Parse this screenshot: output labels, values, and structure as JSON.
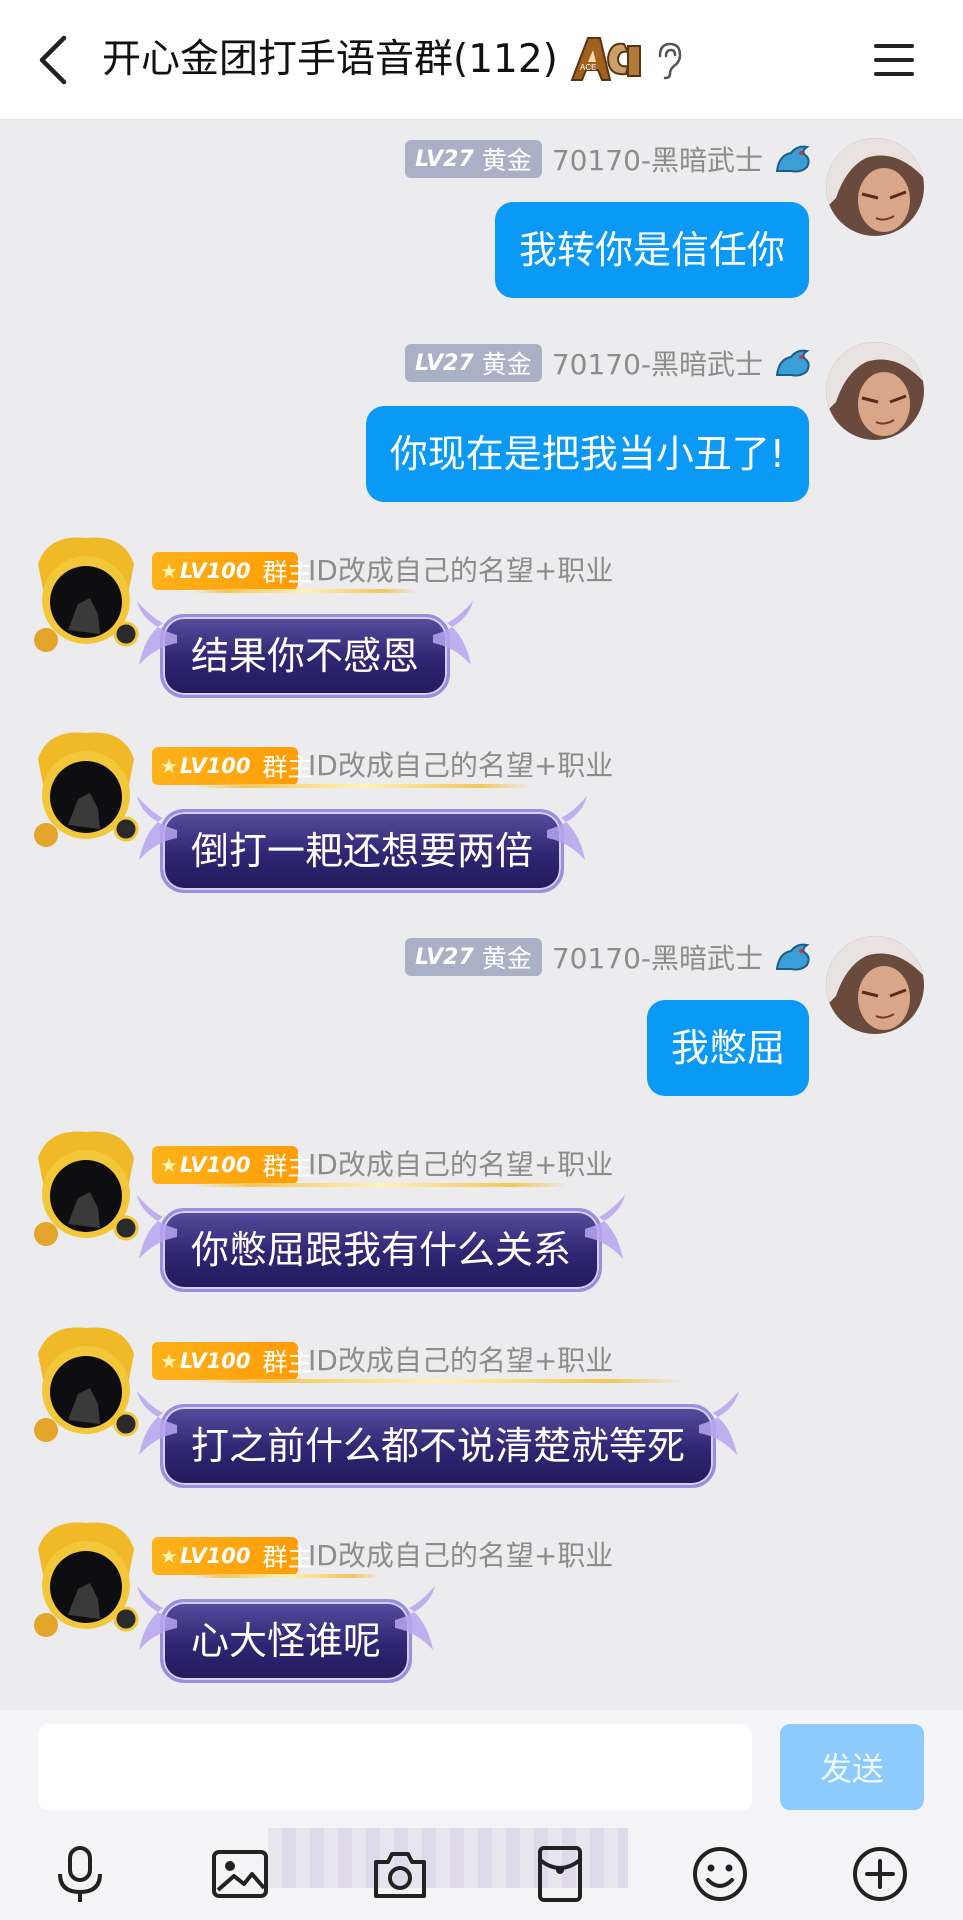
{
  "header": {
    "title": "开心金团打手语音群(112)",
    "ace_badge": "ACE",
    "icons": [
      "back-icon",
      "ear-icon",
      "menu-icon"
    ]
  },
  "self_user": {
    "level": "LV27",
    "rank": "黄金",
    "name": "70170-黑暗武士"
  },
  "owner_user": {
    "level": "LV100",
    "role": "群主",
    "name": "ID改成自己的名望+职业"
  },
  "messages": [
    {
      "side": "self",
      "text": "我转你是信任你"
    },
    {
      "side": "self",
      "text": "你现在是把我当小丑了!"
    },
    {
      "side": "owner",
      "text": "结果你不感恩"
    },
    {
      "side": "owner",
      "text": "倒打一耙还想要两倍"
    },
    {
      "side": "self",
      "text": "我憋屈"
    },
    {
      "side": "owner",
      "text": "你憋屈跟我有什么关系"
    },
    {
      "side": "owner",
      "text": "打之前什么都不说清楚就等死"
    },
    {
      "side": "owner",
      "text": "心大怪谁呢"
    }
  ],
  "input": {
    "value": "",
    "placeholder": "",
    "send_label": "发送"
  },
  "toolbar": {
    "icons": [
      "microphone-icon",
      "image-icon",
      "camera-icon",
      "red-packet-icon",
      "emoji-icon",
      "plus-icon"
    ]
  },
  "colors": {
    "self_bubble": "#0a99f4",
    "owner_bubble": "#2f2572",
    "owner_badge": "#ffa70f",
    "level_badge": "#aab0c6",
    "send_button": "#8ccbfb"
  }
}
